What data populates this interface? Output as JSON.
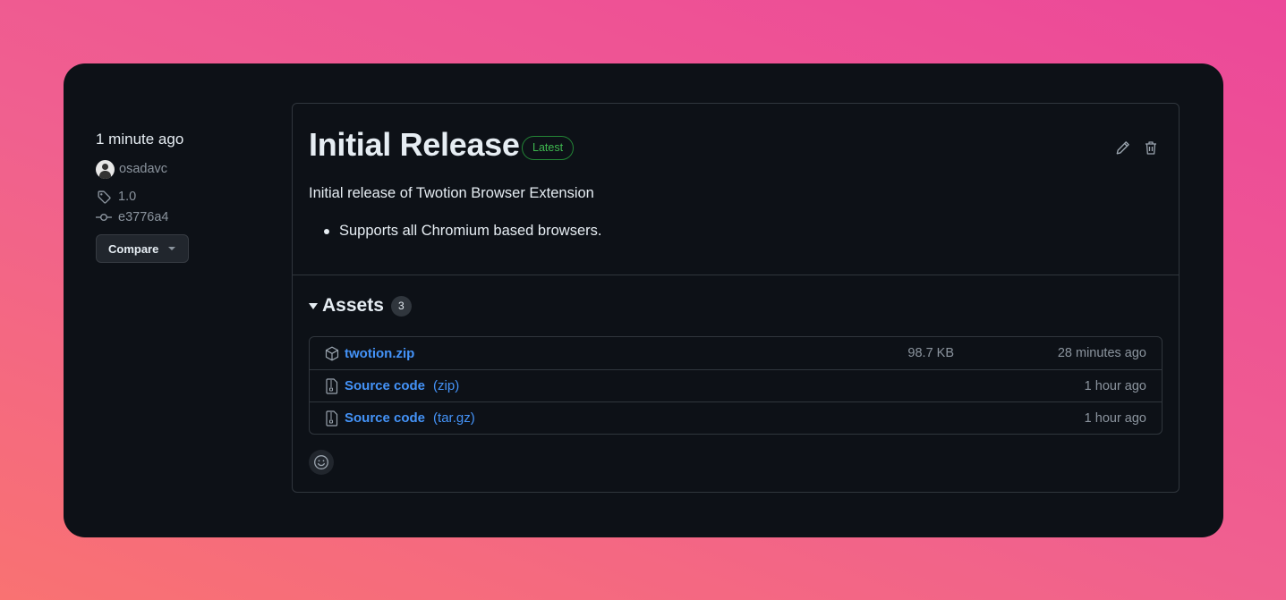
{
  "sidebar": {
    "time": "1 minute ago",
    "author": "osadavc",
    "tag": "1.0",
    "commit": "e3776a4",
    "compare_label": "Compare"
  },
  "release": {
    "title": "Initial Release",
    "badge": "Latest",
    "description": "Initial release of Twotion Browser Extension",
    "bullets": [
      "Supports all Chromium based browsers."
    ]
  },
  "assets": {
    "title": "Assets",
    "count": "3",
    "items": [
      {
        "name": "twotion.zip",
        "ext": "",
        "size": "98.7 KB",
        "time": "28 minutes ago",
        "icon": "package-icon"
      },
      {
        "name": "Source code",
        "ext": "(zip)",
        "size": "",
        "time": "1 hour ago",
        "icon": "file-zip-icon"
      },
      {
        "name": "Source code",
        "ext": "(tar.gz)",
        "size": "",
        "time": "1 hour ago",
        "icon": "file-zip-icon"
      }
    ]
  },
  "colors": {
    "link": "#4493f8",
    "latest": "#3fb950",
    "background": "#0d1117"
  }
}
